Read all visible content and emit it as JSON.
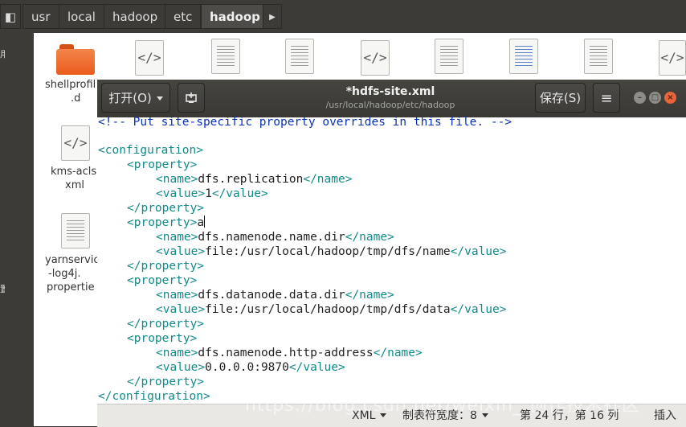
{
  "file_manager": {
    "breadcrumb": [
      "usr",
      "local",
      "hadoop",
      "etc",
      "hadoop"
    ],
    "next_arrow": "▶",
    "back_glyph": "◧",
    "left_chars": [
      "用",
      "置"
    ],
    "files": [
      {
        "name_line1": "shellprofil",
        "name_line2": ".d",
        "type": "folder"
      },
      {
        "name_line1": "kms-acls.",
        "name_line2": "xml",
        "type": "code"
      },
      {
        "name_line1": "yarnservic",
        "name_line2": "-log4j.",
        "name_line3": "propertie",
        "type": "doc"
      }
    ],
    "code_glyph": "</>"
  },
  "editor": {
    "open_label": "打开(O)",
    "title": "*hdfs-site.xml",
    "path": "/usr/local/hadoop/etc/hadoop",
    "save_label": "保存(S)",
    "menu_glyph": "≡",
    "minimize_glyph": "–",
    "maximize_glyph": "□",
    "close_glyph": "×",
    "code_lines": {
      "comment": "<!-- Put site-specific property overrides in this file. -->",
      "config_open": "<configuration>",
      "config_close": "</configuration>",
      "property_open": "<property>",
      "property_close": "</property>",
      "name_open": "<name>",
      "name_close": "</name>",
      "value_open": "<value>",
      "value_close": "</value>",
      "typed_char": "a",
      "p1_name": "dfs.replication",
      "p1_value": "1",
      "p2_name": "dfs.namenode.name.dir",
      "p2_value": "file:/usr/local/hadoop/tmp/dfs/name",
      "p3_name": "dfs.datanode.data.dir",
      "p3_value": "file:/usr/local/hadoop/tmp/dfs/data",
      "p4_name": "dfs.namenode.http-address",
      "p4_value": "0.0.0.0:9870"
    },
    "status": {
      "language": "XML",
      "tab_width_label": "制表符宽度：",
      "tab_width": "8",
      "position": "第 24 行，第 16 列",
      "mode": "插入"
    }
  },
  "watermark": "https://blog.csdn.net/weixin_  创作技术社区"
}
